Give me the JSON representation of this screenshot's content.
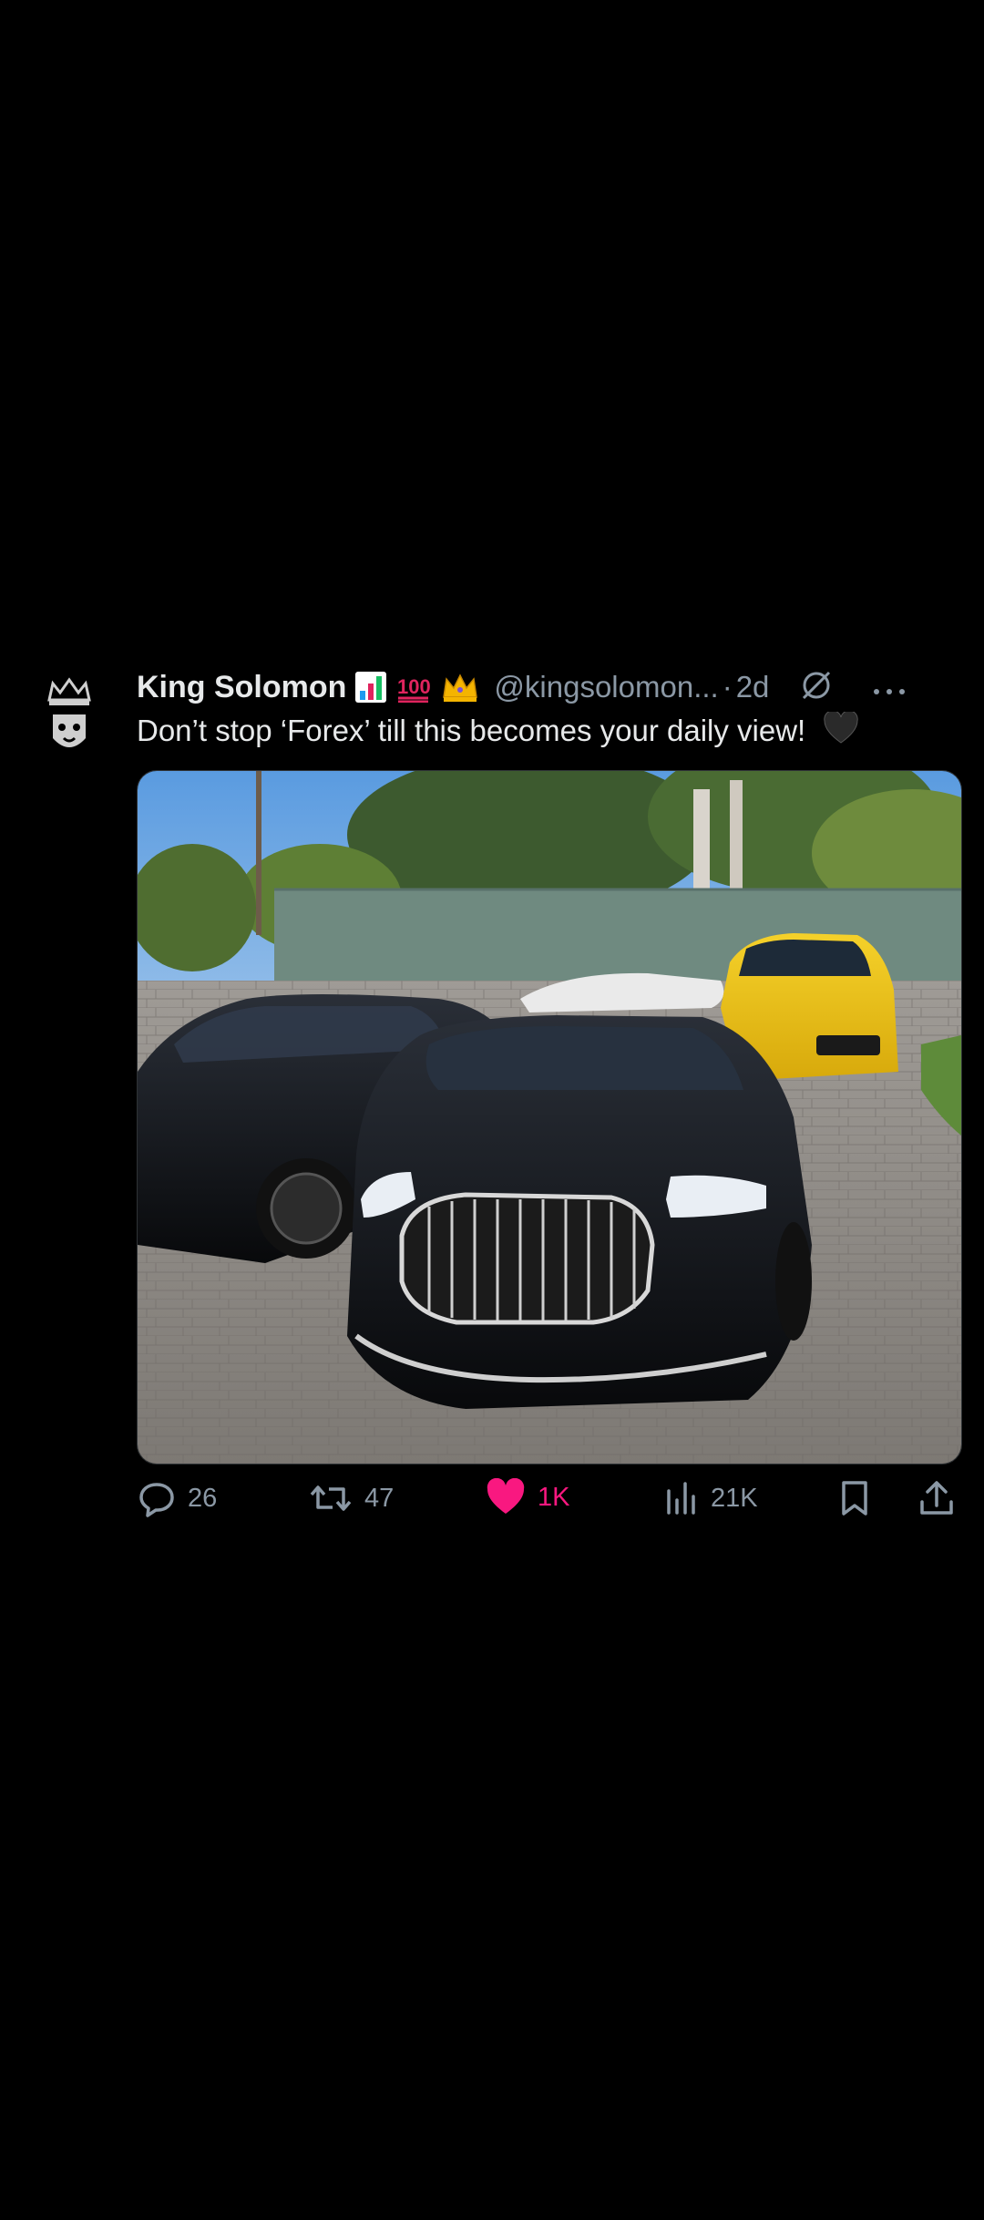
{
  "tweet": {
    "display_name": "King Solomon",
    "badges": [
      "chart-increasing-emoji",
      "hundred-points-emoji",
      "crown-emoji"
    ],
    "handle": "@kingsolomon...",
    "separator": "·",
    "time": "2d",
    "text": "Don’t stop ‘Forex’ till this becomes your daily view!",
    "text_emoji": "black-heart-emoji",
    "media_description_icon": "photo",
    "actions": {
      "replies": "26",
      "reposts": "47",
      "likes": "1K",
      "views": "21K"
    },
    "colors": {
      "like_active": "#f91880",
      "muted": "#8b98a5",
      "text": "#e7e9ea",
      "background": "#000000"
    }
  }
}
